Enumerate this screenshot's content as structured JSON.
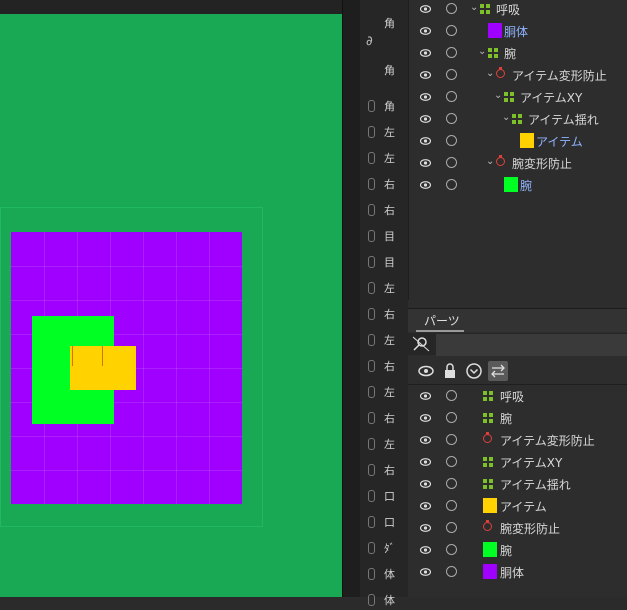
{
  "canvas": {
    "background_color": "#19a954",
    "parts": {
      "body_color": "#a000ff",
      "arm_color": "#00ff22",
      "item_color": "#ffd200"
    }
  },
  "parameters": {
    "top_labels": [
      "角",
      "角"
    ],
    "items": [
      "角",
      "左",
      "左",
      "右",
      "右",
      "目",
      "目",
      "左",
      "右",
      "左",
      "右",
      "左",
      "右",
      "左",
      "右",
      "口",
      "口",
      "ﾀﾞ",
      "体",
      "体"
    ]
  },
  "deformer_tree": {
    "rows": [
      {
        "label": "呼吸",
        "type": "warp",
        "indent": 0,
        "expanded": true
      },
      {
        "label": "胴体",
        "type": "part",
        "color": "#a000ff",
        "indent": 1
      },
      {
        "label": "腕",
        "type": "warp",
        "indent": 1,
        "expanded": true
      },
      {
        "label": "アイテム変形防止",
        "type": "rotation",
        "indent": 2,
        "expanded": true
      },
      {
        "label": "アイテムXY",
        "type": "warp",
        "indent": 3,
        "expanded": true
      },
      {
        "label": "アイテム揺れ",
        "type": "warp",
        "indent": 4,
        "expanded": true
      },
      {
        "label": "アイテム",
        "type": "part",
        "color": "#ffd200",
        "indent": 5
      },
      {
        "label": "腕変形防止",
        "type": "rotation",
        "indent": 2,
        "expanded": true
      },
      {
        "label": "腕",
        "type": "part",
        "color": "#00ff22",
        "indent": 3
      }
    ]
  },
  "parts_panel": {
    "tab_label": "パーツ",
    "search": {
      "placeholder": "",
      "value": ""
    },
    "toolbar_icons": [
      "eye-icon",
      "lock-icon",
      "chevron-circle-icon",
      "swap-icon"
    ],
    "rows": [
      {
        "label": "呼吸",
        "type": "warp"
      },
      {
        "label": "腕",
        "type": "warp"
      },
      {
        "label": "アイテム変形防止",
        "type": "rotation"
      },
      {
        "label": "アイテムXY",
        "type": "warp"
      },
      {
        "label": "アイテム揺れ",
        "type": "warp"
      },
      {
        "label": "アイテム",
        "type": "part",
        "color": "#ffd200"
      },
      {
        "label": "腕変形防止",
        "type": "rotation"
      },
      {
        "label": "腕",
        "type": "part",
        "color": "#00ff22"
      },
      {
        "label": "胴体",
        "type": "part",
        "color": "#a000ff"
      }
    ]
  }
}
